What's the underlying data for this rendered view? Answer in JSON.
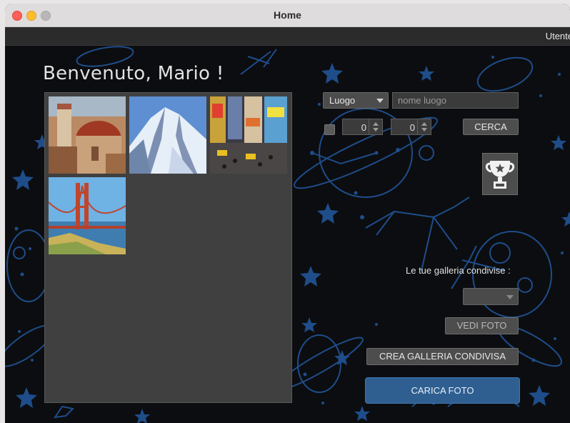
{
  "window": {
    "title": "Home"
  },
  "menubar": {
    "user_label": "Utente"
  },
  "header": {
    "welcome_text": "Benvenuto, Mario !"
  },
  "gallery": {
    "photos": [
      {
        "name": "florence-cathedral-photo"
      },
      {
        "name": "snowy-mountain-photo"
      },
      {
        "name": "times-square-photo"
      },
      {
        "name": "golden-gate-bridge-photo"
      }
    ]
  },
  "search": {
    "type_selected": "Luogo",
    "place_placeholder": "nome luogo",
    "spinner1_value": "0",
    "spinner2_value": "0",
    "search_button": "CERCA"
  },
  "shared": {
    "label": "Le tue galleria condivise :",
    "view_button": "VEDI FOTO",
    "create_button": "CREA GALLERIA CONDIVISA"
  },
  "upload": {
    "button": "CARICA FOTO"
  },
  "colors": {
    "accent": "#2f5f91",
    "background": "#0c0d10",
    "art": "#1f4f8f"
  },
  "icons": {
    "trophy": "trophy-icon"
  }
}
